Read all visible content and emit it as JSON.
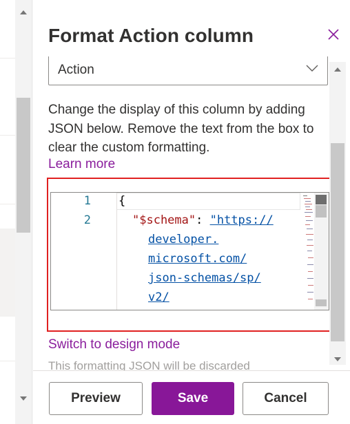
{
  "panel": {
    "title": "Format Action column",
    "close_icon": "close-icon"
  },
  "column_select": {
    "value": "Action",
    "icon": "chevron-down-icon"
  },
  "description": "Change the display of this column by adding JSON below. Remove the text from the box to clear the custom formatting.",
  "learn_more": "Learn more",
  "editor": {
    "line_numbers": [
      "1",
      "2"
    ],
    "line1": "{",
    "schema_key": "\"$schema\"",
    "colon": ": ",
    "url_parts": [
      "\"https://",
      "developer.",
      "microsoft.com/",
      "json-schemas/sp/",
      "v2/"
    ]
  },
  "switch_link": "Switch to design mode",
  "discard_note": "This formatting JSON will be discarded",
  "footer": {
    "preview_label": "Preview",
    "save_label": "Save",
    "cancel_label": "Cancel"
  },
  "colors": {
    "accent": "#881798",
    "link": "#8a1d9c",
    "highlight_border": "#e02020",
    "json_key": "#a31515",
    "json_string": "#0451a5",
    "line_number": "#237893"
  }
}
